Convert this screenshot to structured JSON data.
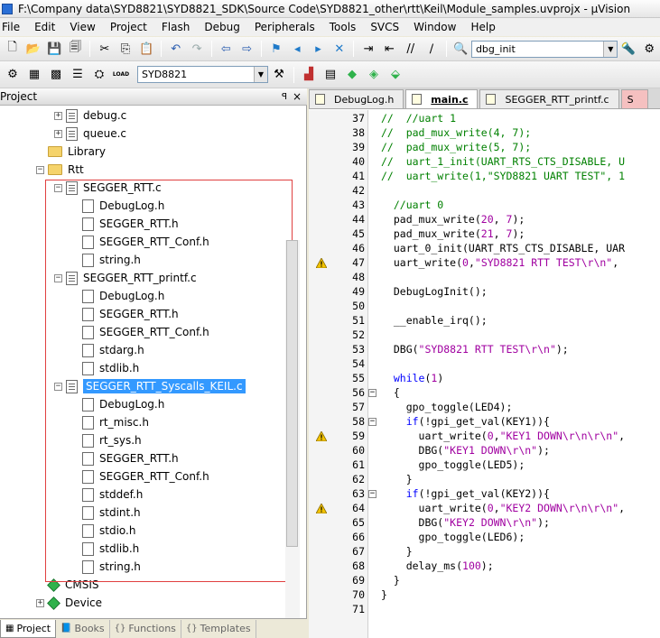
{
  "window": {
    "title": "F:\\Company data\\SYD8821\\SYD8821_SDK\\Source Code\\SYD8821_other\\rtt\\Keil\\Module_samples.uvprojx - µVision"
  },
  "menu": [
    "File",
    "Edit",
    "View",
    "Project",
    "Flash",
    "Debug",
    "Peripherals",
    "Tools",
    "SVCS",
    "Window",
    "Help"
  ],
  "toolbar": {
    "find_combo": "dbg_init",
    "target_combo": "SYD8821",
    "load_label": "LOAD"
  },
  "project_panel": {
    "title": "Project",
    "pin": "ꟼ",
    "close": "×",
    "tree": [
      {
        "label": "debug.c",
        "type": "cfile",
        "exp": "+",
        "indent": 0
      },
      {
        "label": "queue.c",
        "type": "cfile",
        "exp": "+",
        "indent": 0
      },
      {
        "label": "Library",
        "type": "folder",
        "exp": "",
        "indent": -1
      },
      {
        "label": "Rtt",
        "type": "folder",
        "exp": "−",
        "indent": -1
      },
      {
        "label": "SEGGER_RTT.c",
        "type": "cfile",
        "exp": "−",
        "indent": 0
      },
      {
        "label": "DebugLog.h",
        "type": "hfile",
        "exp": "",
        "indent": 1
      },
      {
        "label": "SEGGER_RTT.h",
        "type": "hfile",
        "exp": "",
        "indent": 1
      },
      {
        "label": "SEGGER_RTT_Conf.h",
        "type": "hfile",
        "exp": "",
        "indent": 1
      },
      {
        "label": "string.h",
        "type": "hfile",
        "exp": "",
        "indent": 1
      },
      {
        "label": "SEGGER_RTT_printf.c",
        "type": "cfile",
        "exp": "−",
        "indent": 0
      },
      {
        "label": "DebugLog.h",
        "type": "hfile",
        "exp": "",
        "indent": 1
      },
      {
        "label": "SEGGER_RTT.h",
        "type": "hfile",
        "exp": "",
        "indent": 1
      },
      {
        "label": "SEGGER_RTT_Conf.h",
        "type": "hfile",
        "exp": "",
        "indent": 1
      },
      {
        "label": "stdarg.h",
        "type": "hfile",
        "exp": "",
        "indent": 1
      },
      {
        "label": "stdlib.h",
        "type": "hfile",
        "exp": "",
        "indent": 1
      },
      {
        "label": "SEGGER_RTT_Syscalls_KEIL.c",
        "type": "cfile",
        "exp": "−",
        "indent": 0,
        "selected": true
      },
      {
        "label": "DebugLog.h",
        "type": "hfile",
        "exp": "",
        "indent": 1
      },
      {
        "label": "rt_misc.h",
        "type": "hfile",
        "exp": "",
        "indent": 1
      },
      {
        "label": "rt_sys.h",
        "type": "hfile",
        "exp": "",
        "indent": 1
      },
      {
        "label": "SEGGER_RTT.h",
        "type": "hfile",
        "exp": "",
        "indent": 1
      },
      {
        "label": "SEGGER_RTT_Conf.h",
        "type": "hfile",
        "exp": "",
        "indent": 1
      },
      {
        "label": "stddef.h",
        "type": "hfile",
        "exp": "",
        "indent": 1
      },
      {
        "label": "stdint.h",
        "type": "hfile",
        "exp": "",
        "indent": 1
      },
      {
        "label": "stdio.h",
        "type": "hfile",
        "exp": "",
        "indent": 1
      },
      {
        "label": "stdlib.h",
        "type": "hfile",
        "exp": "",
        "indent": 1
      },
      {
        "label": "string.h",
        "type": "hfile",
        "exp": "",
        "indent": 1
      },
      {
        "label": "CMSIS",
        "type": "gem",
        "exp": "",
        "indent": -1
      },
      {
        "label": "Device",
        "type": "gem",
        "exp": "+",
        "indent": -1
      }
    ],
    "bottom_tabs": [
      "Project",
      "Books",
      "Functions",
      "Templates"
    ]
  },
  "editor": {
    "tabs": [
      "DebugLog.h",
      "main.c",
      "SEGGER_RTT_printf.c",
      "S"
    ],
    "active_tab": 1,
    "lines": [
      {
        "n": "37",
        "text": "//  //uart 1",
        "cls": "comment"
      },
      {
        "n": "38",
        "text": "//  pad_mux_write(4, 7);",
        "cls": "comment"
      },
      {
        "n": "39",
        "text": "//  pad_mux_write(5, 7);",
        "cls": "comment"
      },
      {
        "n": "40",
        "text": "//  uart_1_init(UART_RTS_CTS_DISABLE, U",
        "cls": "comment"
      },
      {
        "n": "41",
        "text": "//  uart_write(1,\"SYD8821 UART TEST\", 1",
        "cls": "comment"
      },
      {
        "n": "42",
        "text": "",
        "cls": ""
      },
      {
        "n": "43",
        "text": "  //uart 0",
        "cls": "comment"
      },
      {
        "n": "44",
        "text": "  pad_mux_write(20, 7);",
        "cls": "fn"
      },
      {
        "n": "45",
        "text": "  pad_mux_write(21, 7);",
        "cls": "fn"
      },
      {
        "n": "46",
        "text": "  uart_0_init(UART_RTS_CTS_DISABLE, UAR",
        "cls": "fn"
      },
      {
        "n": "47",
        "text": "  uart_write(0,\"SYD8821 RTT TEST\\r\\n\",",
        "cls": "fn",
        "warn": true
      },
      {
        "n": "48",
        "text": "",
        "cls": ""
      },
      {
        "n": "49",
        "text": "  DebugLogInit();",
        "cls": "fn"
      },
      {
        "n": "50",
        "text": "",
        "cls": ""
      },
      {
        "n": "51",
        "text": "  __enable_irq();",
        "cls": "fn"
      },
      {
        "n": "52",
        "text": "",
        "cls": ""
      },
      {
        "n": "53",
        "text": "  DBG(\"SYD8821 RTT TEST\\r\\n\");",
        "cls": "fn"
      },
      {
        "n": "54",
        "text": "",
        "cls": ""
      },
      {
        "n": "55",
        "text": "  while(1)",
        "cls": "kwline"
      },
      {
        "n": "56",
        "text": "  {",
        "cls": "fn",
        "fold": "−"
      },
      {
        "n": "57",
        "text": "    gpo_toggle(LED4);",
        "cls": "fn"
      },
      {
        "n": "58",
        "text": "    if(!gpi_get_val(KEY1)){",
        "cls": "ifline",
        "fold": "−"
      },
      {
        "n": "59",
        "text": "      uart_write(0,\"KEY1 DOWN\\r\\n\\r\\n\",",
        "cls": "fn",
        "warn": true
      },
      {
        "n": "60",
        "text": "      DBG(\"KEY1 DOWN\\r\\n\");",
        "cls": "fn"
      },
      {
        "n": "61",
        "text": "      gpo_toggle(LED5);",
        "cls": "fn"
      },
      {
        "n": "62",
        "text": "    }",
        "cls": "fn"
      },
      {
        "n": "63",
        "text": "    if(!gpi_get_val(KEY2)){",
        "cls": "ifline",
        "fold": "−"
      },
      {
        "n": "64",
        "text": "      uart_write(0,\"KEY2 DOWN\\r\\n\\r\\n\",",
        "cls": "fn",
        "warn": true
      },
      {
        "n": "65",
        "text": "      DBG(\"KEY2 DOWN\\r\\n\");",
        "cls": "fn"
      },
      {
        "n": "66",
        "text": "      gpo_toggle(LED6);",
        "cls": "fn"
      },
      {
        "n": "67",
        "text": "    }",
        "cls": "fn"
      },
      {
        "n": "68",
        "text": "    delay_ms(100);",
        "cls": "fn"
      },
      {
        "n": "69",
        "text": "  }",
        "cls": "fn"
      },
      {
        "n": "70",
        "text": "}",
        "cls": "fn"
      },
      {
        "n": "71",
        "text": "",
        "cls": ""
      }
    ]
  }
}
